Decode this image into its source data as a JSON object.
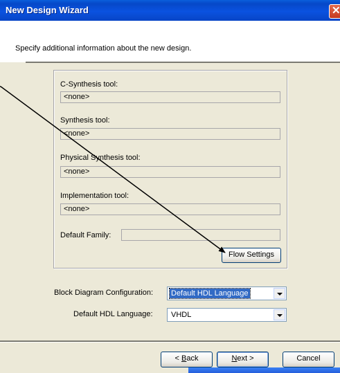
{
  "window": {
    "title": "New Design Wizard",
    "close_glyph": "✕"
  },
  "header": {
    "instruction": "Specify additional information about the new design."
  },
  "tools_group": {
    "c_synthesis": {
      "label": "C-Synthesis tool:",
      "value": "<none>"
    },
    "synthesis": {
      "label": "Synthesis tool:",
      "value": "<none>"
    },
    "physical_synthesis": {
      "label": "Physical Synthesis tool:",
      "value": "<none>"
    },
    "implementation": {
      "label": "Implementation tool:",
      "value": "<none>"
    },
    "default_family": {
      "label": "Default Family:",
      "value": ""
    },
    "flow_settings_label": "Flow Settings"
  },
  "block_diagram": {
    "label": "Block Diagram Configuration:",
    "selected": "Default HDL Language"
  },
  "hdl_language": {
    "label": "Default HDL Language:",
    "selected": "VHDL"
  },
  "footer": {
    "back": {
      "prefix": "< ",
      "accel": "B",
      "rest": "ack"
    },
    "next": {
      "accel": "N",
      "rest": "ext >"
    },
    "cancel_label": "Cancel"
  },
  "colors": {
    "title_bar": "#0a52e0",
    "dialog_bg": "#ece9d8",
    "arrow": "#000000",
    "selection": "#316ac5"
  }
}
